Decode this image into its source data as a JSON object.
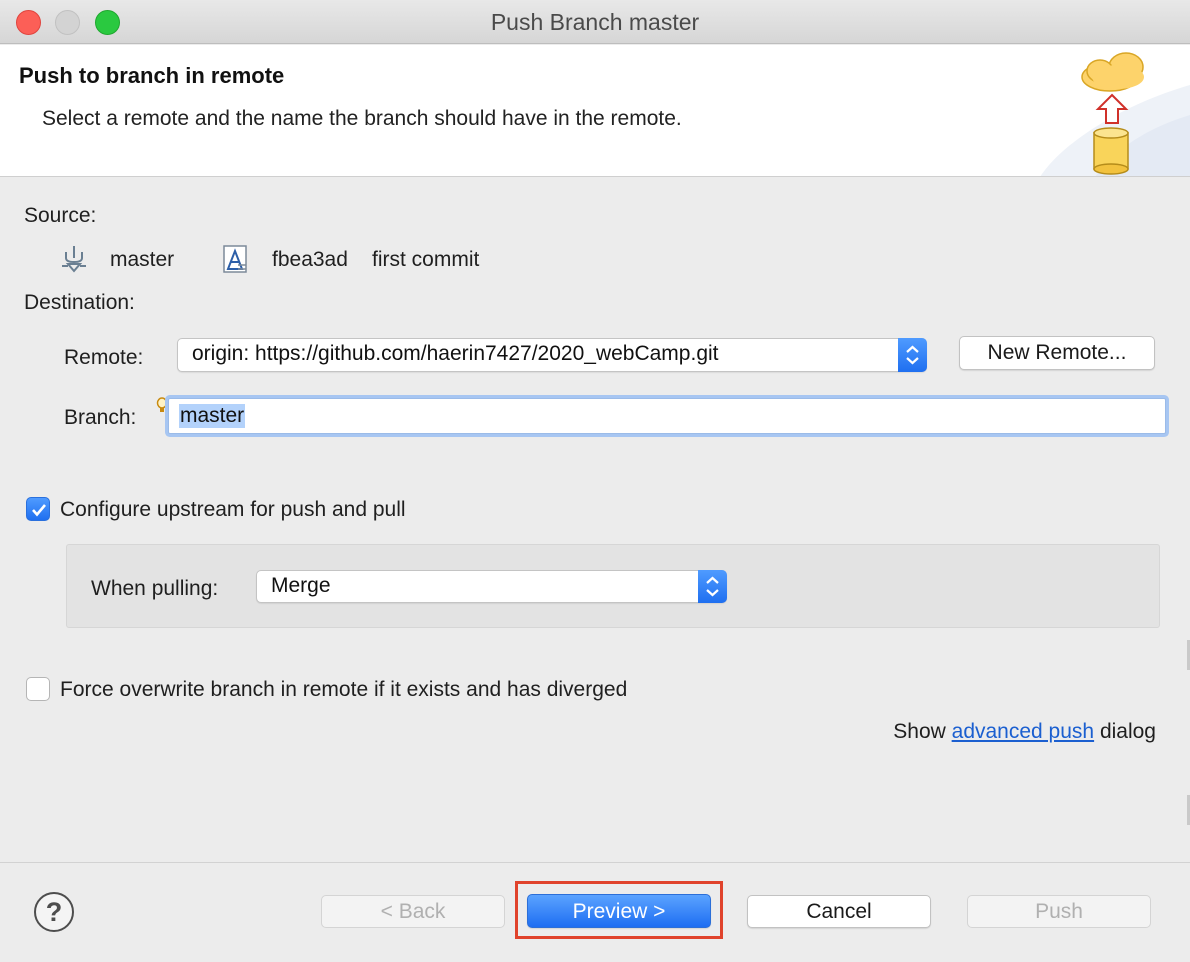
{
  "window": {
    "title": "Push Branch master"
  },
  "header": {
    "title": "Push to branch in remote",
    "description": "Select a remote and the name the branch should have in the remote."
  },
  "source": {
    "label": "Source:",
    "branch": "master",
    "commit_id": "fbea3ad",
    "commit_message": "first commit"
  },
  "destination": {
    "label": "Destination:",
    "remote_label": "Remote:",
    "remote_value": "origin: https://github.com/haerin7427/2020_webCamp.git",
    "new_remote_button": "New Remote...",
    "branch_label": "Branch:",
    "branch_value": "master"
  },
  "upstream": {
    "checkbox_label": "Configure upstream for push and pull",
    "checked": true,
    "when_pulling_label": "When pulling:",
    "when_pulling_value": "Merge"
  },
  "force": {
    "checkbox_label": "Force overwrite branch in remote if it exists and has diverged",
    "checked": false
  },
  "advanced": {
    "prefix": "Show",
    "link": "advanced push",
    "suffix": "dialog"
  },
  "footer": {
    "help": "?",
    "back_button": "< Back",
    "preview_button": "Preview >",
    "cancel_button": "Cancel",
    "push_button": "Push"
  },
  "colors": {
    "accent": "#1e6ef2",
    "highlight": "#e0432c",
    "link": "#1b5fd0"
  }
}
